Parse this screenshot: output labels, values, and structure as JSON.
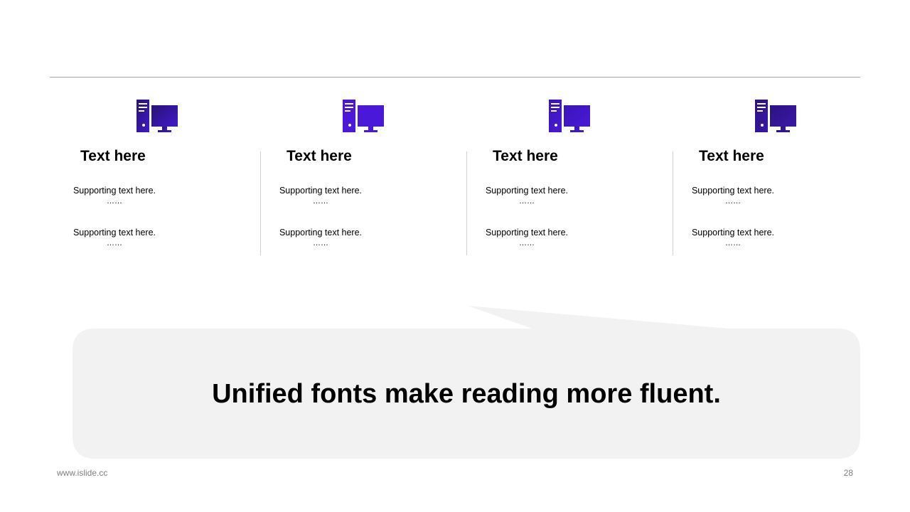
{
  "slide": {
    "columns": [
      {
        "icon": "desktop-computer-icon",
        "icon_color_start": "#2a1273",
        "icon_color_end": "#3f1acb",
        "title": "Text here",
        "supports": [
          {
            "text": "Supporting  text here.",
            "ellipsis": "……"
          },
          {
            "text": "Supporting  text here.",
            "ellipsis": "……"
          }
        ]
      },
      {
        "icon": "desktop-computer-icon",
        "icon_color_start": "#4a18d8",
        "icon_color_end": "#4a18d8",
        "title": "Text here",
        "supports": [
          {
            "text": "Supporting  text here.",
            "ellipsis": "……"
          },
          {
            "text": "Supporting  text here.",
            "ellipsis": "……"
          }
        ]
      },
      {
        "icon": "desktop-computer-icon",
        "icon_color_start": "#3a16b8",
        "icon_color_end": "#4a18d8",
        "title": "Text here",
        "supports": [
          {
            "text": "Supporting  text here.",
            "ellipsis": "……"
          },
          {
            "text": "Supporting  text here.",
            "ellipsis": "……"
          }
        ]
      },
      {
        "icon": "desktop-computer-icon",
        "icon_color_start": "#2c1380",
        "icon_color_end": "#3a17a8",
        "title": "Text here",
        "supports": [
          {
            "text": "Supporting  text here.",
            "ellipsis": "……"
          },
          {
            "text": "Supporting  text here.",
            "ellipsis": "……"
          }
        ]
      }
    ],
    "callout_text": "Unified fonts make reading more fluent.",
    "callout_color": "#f2f2f2"
  },
  "footer": {
    "url": "www.islide.cc",
    "page_number": "28"
  }
}
